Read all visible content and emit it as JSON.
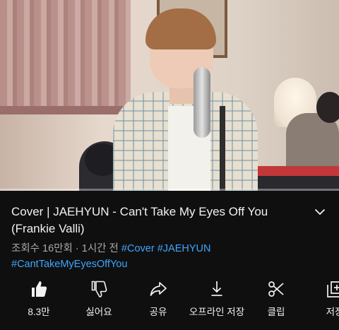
{
  "video": {
    "title": "Cover | JAEHYUN - Can't Take My Eyes Off You (Frankie Valli)",
    "progress_fraction": 0.0
  },
  "meta": {
    "views": "조회수 16만회",
    "separator": "·",
    "time_ago": "1시간 전",
    "hashtags": [
      "#Cover",
      "#JAEHYUN",
      "#CantTakeMyEyesOffYou"
    ]
  },
  "actions": [
    {
      "icon": "thumbs-up-icon",
      "label": "8.3만"
    },
    {
      "icon": "thumbs-down-icon",
      "label": "싫어요"
    },
    {
      "icon": "share-icon",
      "label": "공유"
    },
    {
      "icon": "download-icon",
      "label": "오프라인 저장"
    },
    {
      "icon": "scissors-icon",
      "label": "클립"
    },
    {
      "icon": "save-playlist-icon",
      "label": "저장"
    }
  ],
  "colors": {
    "background": "#0f0f0f",
    "hashtag": "#3ea6ff",
    "progress": "#ff0000",
    "meta_text": "#aaaaaa"
  }
}
